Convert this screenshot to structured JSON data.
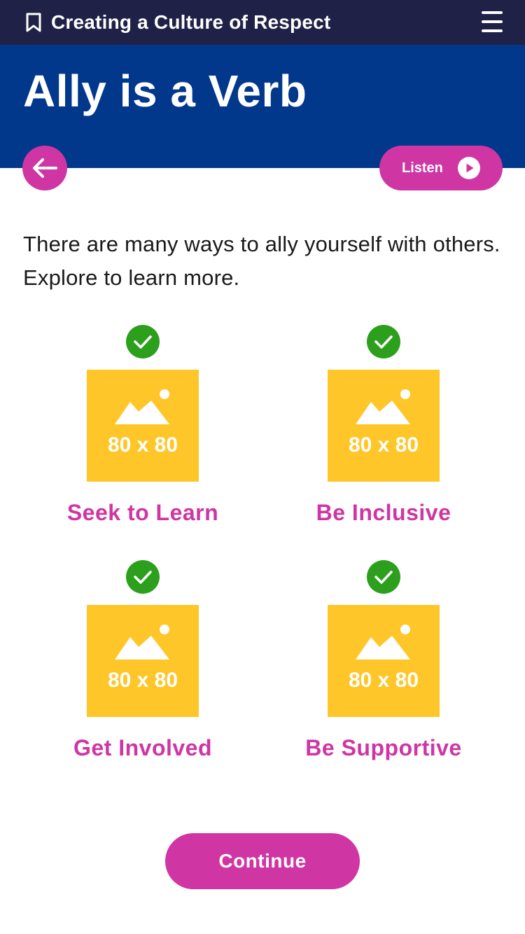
{
  "header": {
    "course_title": "Creating a Culture of Respect",
    "bookmark_icon": "bookmark-icon",
    "menu_icon": "hamburger-menu-icon"
  },
  "hero": {
    "title": "Ally is a Verb",
    "back_icon": "arrow-left-icon",
    "listen_label": "Listen",
    "listen_icon": "play-icon"
  },
  "intro_text": "There are many ways to ally yourself with others. Explore to learn more.",
  "tiles": [
    {
      "label": "Seek to Learn",
      "image_placeholder": "80 x 80",
      "completed": true,
      "status_icon": "checkmark-icon"
    },
    {
      "label": "Be Inclusive",
      "image_placeholder": "80 x 80",
      "completed": true,
      "status_icon": "checkmark-icon"
    },
    {
      "label": "Get Involved",
      "image_placeholder": "80 x 80",
      "completed": true,
      "status_icon": "checkmark-icon"
    },
    {
      "label": "Be Supportive",
      "image_placeholder": "80 x 80",
      "completed": true,
      "status_icon": "checkmark-icon"
    }
  ],
  "continue_label": "Continue",
  "colors": {
    "topbar": "#1f2147",
    "hero": "#02388c",
    "accent": "#cf35a3",
    "success": "#2c9f1c",
    "placeholder": "#ffc629"
  }
}
